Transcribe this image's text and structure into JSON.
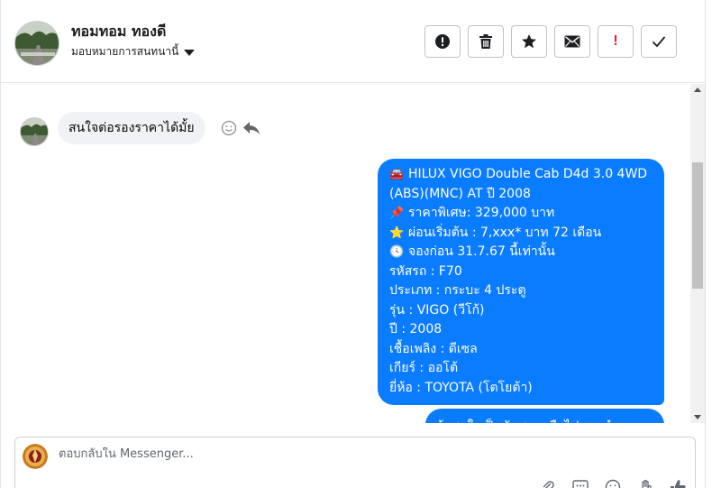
{
  "header": {
    "contact_name": "ทอมทอม ทองดี",
    "assign_label": "มอบหมายการสนทนานี้",
    "actions": [
      {
        "icon": "exclamation-circle-icon",
        "label": "Mark as spam"
      },
      {
        "icon": "trash-icon",
        "label": "Delete"
      },
      {
        "icon": "star-icon",
        "label": "Star"
      },
      {
        "icon": "envelope-icon",
        "label": "Mark as unread"
      },
      {
        "icon": "red-exclamation-icon",
        "label": "Follow up",
        "glyph": "!"
      },
      {
        "icon": "checkmark-icon",
        "label": "Mark as done"
      }
    ],
    "accent_color": "#e41e3f"
  },
  "thread": {
    "incoming_message": "สนใจต่อรองราคาได้มั้ย",
    "outgoing_message": {
      "title_emoji": "🚘",
      "title": "HILUX VIGO Double Cab D4d 3.0 4WD (ABS)(MNC) AT ปี 2008",
      "price_emoji": "📌",
      "price": "ราคาพิเศษ: 329,000 บาท",
      "installment_emoji": "⭐",
      "installment": "ผ่อนเริ่มต้น : 7,xxx* บาท 72 เดือน",
      "deadline_emoji": "🕓",
      "deadline": "จองก่อน 31.7.67 นี้เท่านั้น",
      "code": "รหัสรถ : F70",
      "type": "ประเภท : กระบะ 4 ประตู",
      "model": "รุ่น : VIGO (วีโก้)",
      "year": "ปี : 2008",
      "fuel": "เชื้อเพลิง : ดีเซล",
      "gear": "เกียร์ : ออโต้",
      "brand": "ยี่ห้อ : TOYOTA (โตโยต้า)"
    },
    "outgoing_partial": "ถ้าสนใจเป็นนัดสอบหรือไปแนะทำง",
    "bubble_color": "#0a7cff"
  },
  "composer": {
    "placeholder": "ตอบกลับใน Messenger..."
  }
}
